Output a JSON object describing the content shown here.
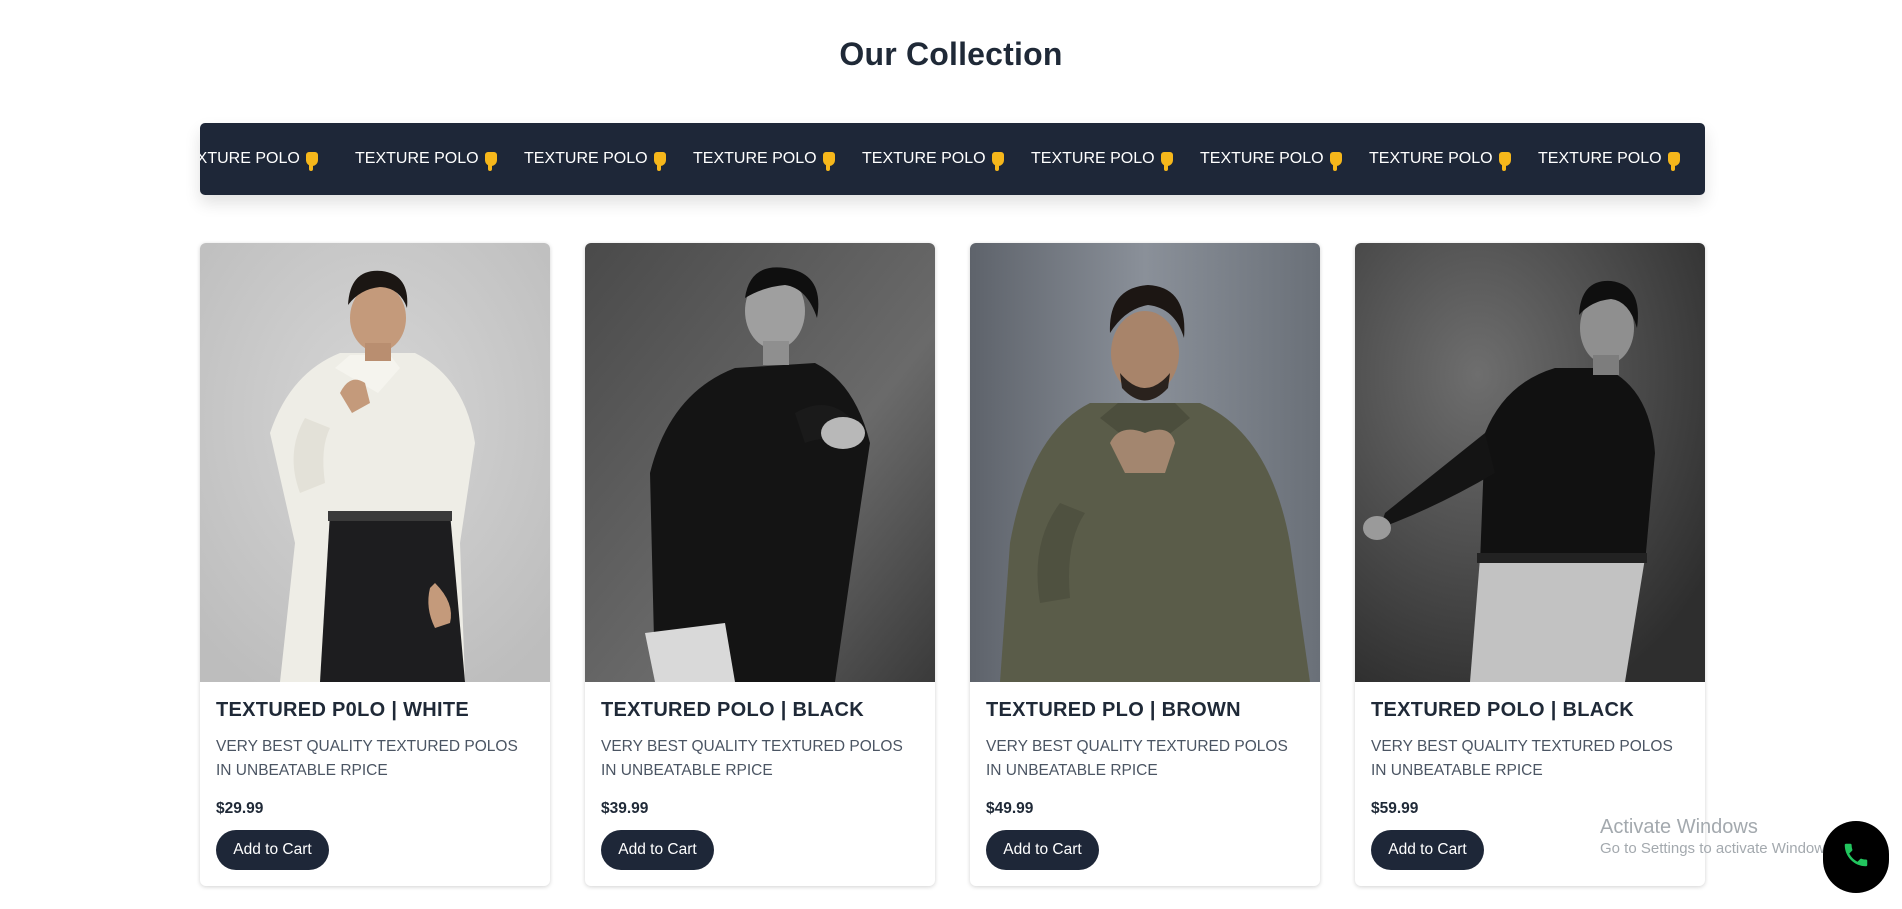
{
  "section": {
    "title": "Our Collection"
  },
  "marquee": {
    "items": [
      "TEXTURE POLO",
      "TEXTURE POLO",
      "TEXTURE POLO",
      "TEXTURE POLO",
      "TEXTURE POLO",
      "TEXTURE POLO",
      "TEXTURE POLO",
      "TEXTURE POLO",
      "TEXTURE POLO"
    ],
    "first_item_visible": "EXTURE POLO",
    "icon": "pointing-down-hand-icon",
    "background_color": "#1e2738",
    "icon_color": "#f6b71b"
  },
  "products": [
    {
      "title": "TEXTURED P0LO | WHITE",
      "description": "VERY BEST QUALITY TEXTURED POLOS IN UNBEATABLE RPICE",
      "price": "$29.99",
      "button_label": "Add to Cart"
    },
    {
      "title": "TEXTURED POLO | BLACK",
      "description": "VERY BEST QUALITY TEXTURED POLOS IN UNBEATABLE RPICE",
      "price": "$39.99",
      "button_label": "Add to Cart"
    },
    {
      "title": "TEXTURED PLO | BROWN",
      "description": "VERY BEST QUALITY TEXTURED POLOS IN UNBEATABLE RPICE",
      "price": "$49.99",
      "button_label": "Add to Cart"
    },
    {
      "title": "TEXTURED POLO | BLACK",
      "description": "VERY BEST QUALITY TEXTURED POLOS IN UNBEATABLE RPICE",
      "price": "$59.99",
      "button_label": "Add to Cart"
    }
  ],
  "watermark": {
    "title": "Activate Windows",
    "subtitle": "Go to Settings to activate Windows."
  },
  "call_button": {
    "icon": "phone-icon",
    "icon_color": "#22c55e"
  },
  "colors": {
    "accent": "#1e2738",
    "text": "#1f2937",
    "muted_text": "#4b5563"
  }
}
